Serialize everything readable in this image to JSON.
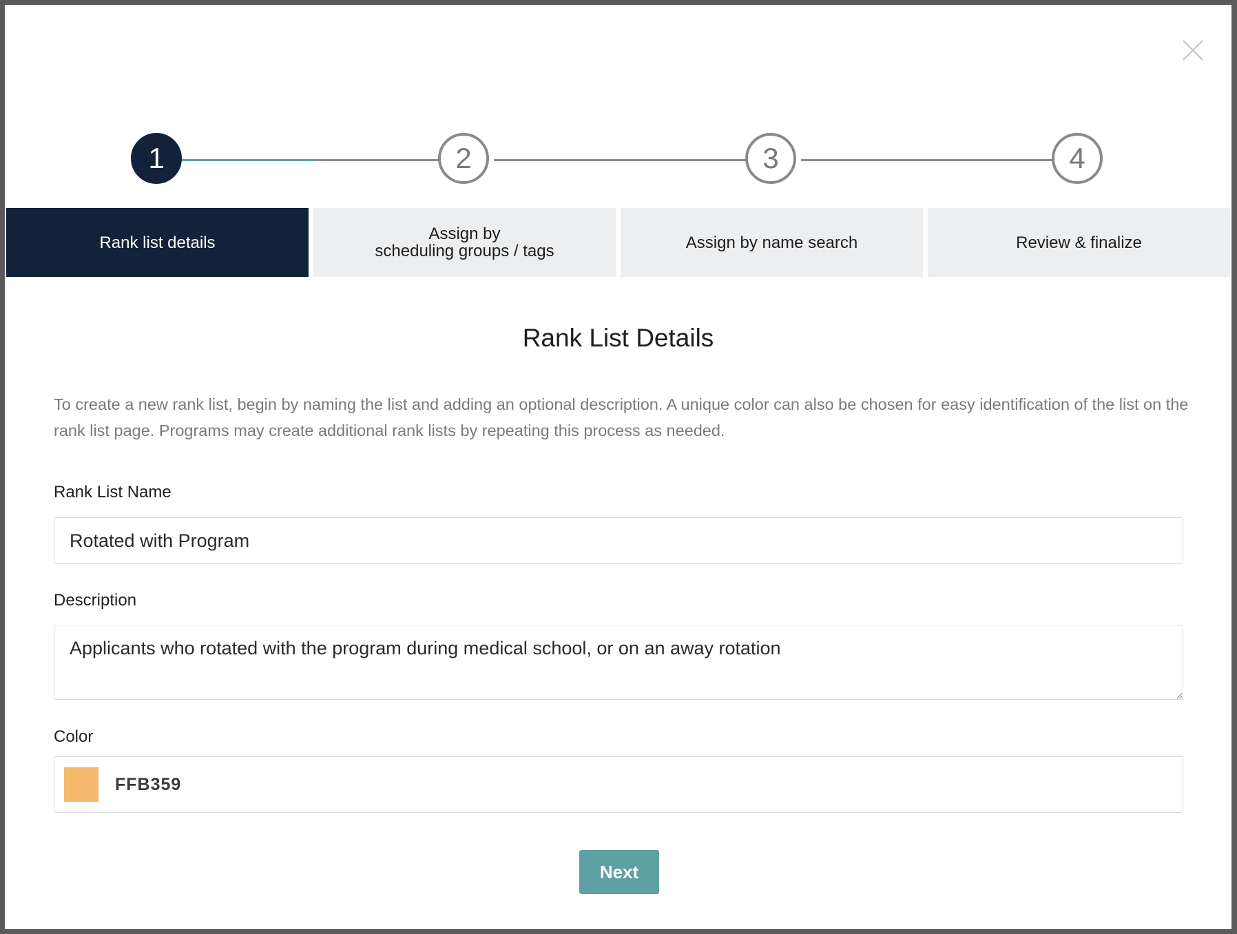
{
  "modal": {
    "close_icon": "close-icon",
    "steps": [
      {
        "number": "1",
        "label": "Rank list details",
        "active": true
      },
      {
        "number": "2",
        "label": "Assign by\nscheduling groups / tags",
        "active": false
      },
      {
        "number": "3",
        "label": "Assign by name search",
        "active": false
      },
      {
        "number": "4",
        "label": "Review & finalize",
        "active": false
      }
    ],
    "title": "Rank List Details",
    "intro": "To create a new rank list, begin by naming the list and adding an optional description. A unique color can also be chosen for easy identification of the list on the rank list page. Programs may create additional rank lists by repeating this process as needed.",
    "name_field": {
      "label": "Rank List Name",
      "value": "Rotated with Program"
    },
    "description_field": {
      "label": "Description",
      "value": "Applicants who rotated with the program during medical school, or on an away rotation"
    },
    "color_field": {
      "label": "Color",
      "value": "FFB359",
      "swatch": "#f4b86c"
    },
    "next_label": "Next"
  },
  "colors": {
    "navy": "#13223a",
    "teal": "#5fa0a3",
    "tab_inactive": "#edeef0"
  }
}
